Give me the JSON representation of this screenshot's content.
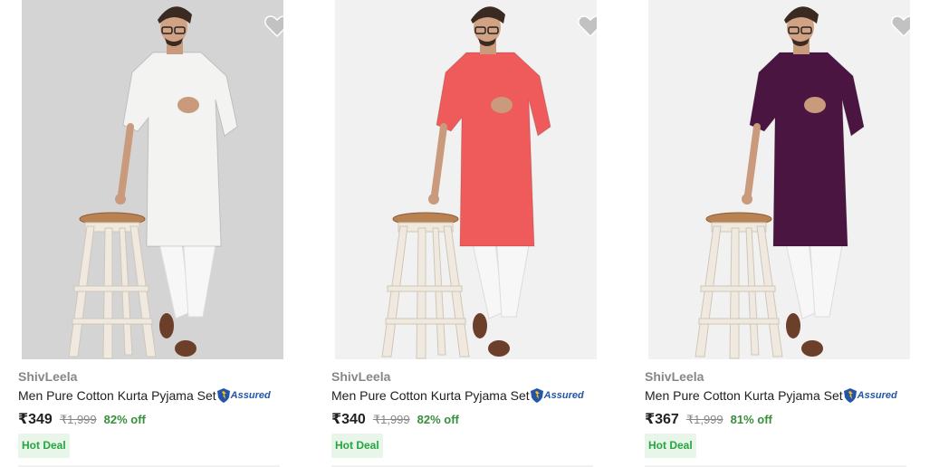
{
  "products": [
    {
      "brand": "ShivLeela",
      "title": "Men Pure Cotton Kurta Pyjama Set",
      "assured_label": "Assured",
      "price": "₹349",
      "mrp": "₹1,999",
      "discount": "82% off",
      "badge": "Hot Deal",
      "kurta_color": "#f3f3f1",
      "bg_color": "#d4d4d4"
    },
    {
      "brand": "ShivLeela",
      "title": "Men Pure Cotton Kurta Pyjama Set",
      "assured_label": "Assured",
      "price": "₹340",
      "mrp": "₹1,999",
      "discount": "82% off",
      "badge": "Hot Deal",
      "kurta_color": "#ef5a5a",
      "bg_color": "#f1f1f1"
    },
    {
      "brand": "ShivLeela",
      "title": "Men Pure Cotton Kurta Pyjama Set",
      "assured_label": "Assured",
      "price": "₹367",
      "mrp": "₹1,999",
      "discount": "81% off",
      "badge": "Hot Deal",
      "kurta_color": "#4a1540",
      "bg_color": "#f1f1f1"
    }
  ],
  "colors": {
    "wishlist_heart": "#c2c2c2",
    "assured_blue": "#2455a6",
    "assured_gold": "#f9c01f",
    "discount_green": "#388e3c",
    "badge_bg": "#e8f5e9"
  }
}
